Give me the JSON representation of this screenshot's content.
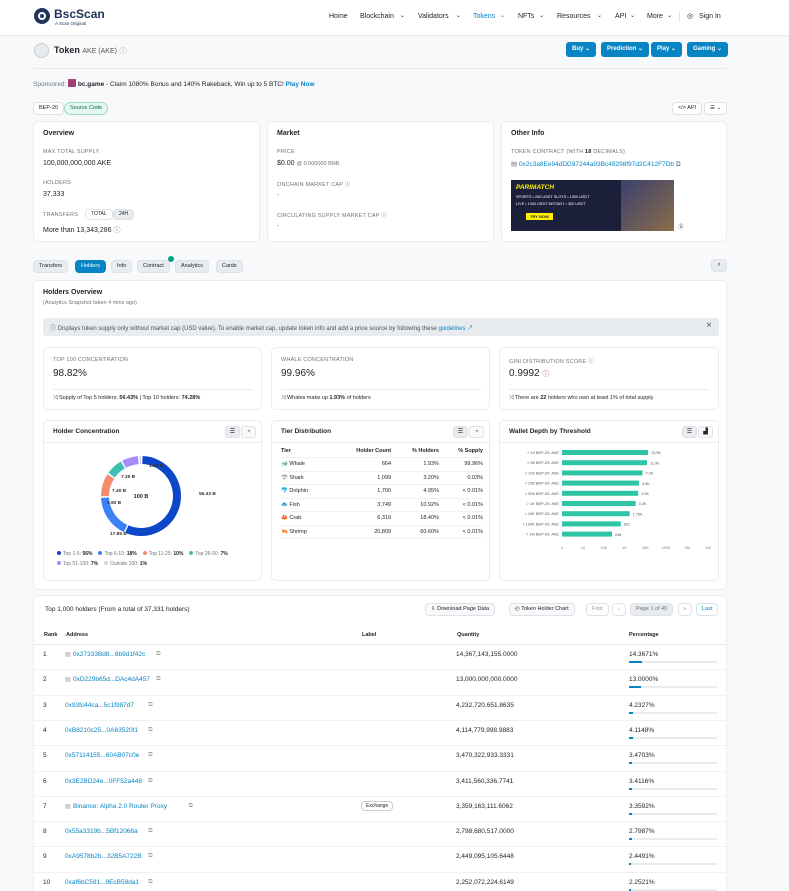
{
  "brand": {
    "name": "BscScan",
    "tagline": "A Scan Original"
  },
  "nav": [
    {
      "label": "Home"
    },
    {
      "label": "Blockchain"
    },
    {
      "label": "Validators"
    },
    {
      "label": "Tokens"
    },
    {
      "label": "NFTs"
    },
    {
      "label": "Resources"
    },
    {
      "label": "API"
    },
    {
      "label": "More"
    },
    {
      "label": "Sign In"
    }
  ],
  "token": {
    "prefix": "Token",
    "name": "AKE (AKE)"
  },
  "actions": {
    "buy": "Buy",
    "prediction": "Prediction",
    "play": "Play",
    "gaming": "Gaming"
  },
  "sponsored": {
    "label": "Sponsored:",
    "name": "bc.game",
    "text": " - Claim 1080% Bonus and 140% Rakeback, Win up to 5 BTC!",
    "link": "Play Now"
  },
  "badges": {
    "bep20": "BEP-20",
    "source": "Source Code",
    "api": "API"
  },
  "overview": {
    "title": "Overview",
    "max_supply_label": "MAX TOTAL SUPPLY",
    "max_supply": "100,000,000,000 AKE",
    "holders_label": "HOLDERS",
    "holders": "37,333",
    "transfers_label": "TRANSFERS",
    "total_tab": "TOTAL",
    "h24_tab": "24H",
    "transfers": "More than 13,343,286"
  },
  "market": {
    "title": "Market",
    "price_label": "PRICE",
    "price": "$0.00",
    "price_bnb": "@ 0.000000 BNB",
    "onchain_label": "ONCHAIN MARKET CAP",
    "onchain": "-",
    "circ_label": "CIRCULATING SUPPLY MARKET CAP",
    "circ": "-"
  },
  "other": {
    "title": "Other Info",
    "contract_label_a": "TOKEN CONTRACT (WITH ",
    "contract_decimals": "18",
    "contract_label_b": " DECIMALS)",
    "contract": "0x2c3a8Ee94dDD97244a93Bc48298f97d2C412F7Db"
  },
  "ad": {
    "brand": "PARIMATCH",
    "line1": "SPORTS • 200 USDT  SLOTS • 1300 USDT",
    "line2": "LIVE • 1000 USDT  INSTANT • 300 USDT",
    "cta": "TRY NOW"
  },
  "tabs": [
    {
      "label": "Transfers"
    },
    {
      "label": "Holders"
    },
    {
      "label": "Info"
    },
    {
      "label": "Contract"
    },
    {
      "label": "Analytics"
    },
    {
      "label": "Cards"
    }
  ],
  "holders_overview": {
    "title": "Holders Overview",
    "subtitle": "(Analytics Snapshot taken 4 mins ago)",
    "notice": "Displays token supply only without market cap (USD value). To enable market cap, update token info and add a price source by following these ",
    "notice_link": "guidelines"
  },
  "stats": [
    {
      "label": "TOP 100 CONCENTRATION",
      "value": "98.82%",
      "foot_a": "Supply of Top 5 holders: ",
      "foot_b": "56.43%",
      "foot_c": " | Top 10 holders: ",
      "foot_d": "74.28%"
    },
    {
      "label": "WHALE CONCENTRATION",
      "value": "99.96%",
      "foot_a": "Whales make up ",
      "foot_b": "1.93%",
      "foot_c": " of holders",
      "foot_d": ""
    },
    {
      "label": "GINI DISTRIBUTION SCORE",
      "value": "0.9992",
      "foot_a": "There are ",
      "foot_b": "22",
      "foot_c": " holders who own at least 1% of total supply",
      "foot_d": ""
    }
  ],
  "concentration": {
    "title": "Holder Concentration",
    "center": "100 B",
    "slices": [
      {
        "label": "56.43 B",
        "value": 56.43,
        "color": "#0d47c9"
      },
      {
        "label": "17.85 B",
        "value": 17.85,
        "color": "#3b82f6"
      },
      {
        "label": "9.90 B",
        "value": 9.9,
        "color": "#f28c6a"
      },
      {
        "label": "7.40 B",
        "value": 7.4,
        "color": "#3ec1b4"
      },
      {
        "label": "7.25 B",
        "value": 7.25,
        "color": "#a78bfa"
      },
      {
        "label": "1.18 B",
        "value": 1.18,
        "color": "#cbd5e1"
      }
    ],
    "legend": [
      {
        "name": "Top 1-5:",
        "pct": "56%",
        "color": "#0d47c9"
      },
      {
        "name": "Top 6-10:",
        "pct": "18%",
        "color": "#3b82f6"
      },
      {
        "name": "Top 11-25:",
        "pct": "10%",
        "color": "#f28c6a"
      },
      {
        "name": "Top 26-50:",
        "pct": "7%",
        "color": "#3ec1b4"
      },
      {
        "name": "Top 51-100:",
        "pct": "7%",
        "color": "#a78bfa"
      },
      {
        "name": "Outside 100:",
        "pct": "1%",
        "color": "#cbd5e1"
      }
    ]
  },
  "tiers": {
    "title": "Tier Distribution",
    "headers": [
      "Tier",
      "Holder Count",
      "% Holders",
      "% Supply"
    ],
    "rows": [
      {
        "icon": "🐋",
        "tier": "Whale",
        "count": "664",
        "holders": "1.93%",
        "supply": "99.96%"
      },
      {
        "icon": "🦈",
        "tier": "Shark",
        "count": "1,099",
        "holders": "3.20%",
        "supply": "0.03%"
      },
      {
        "icon": "🐬",
        "tier": "Dolphin",
        "count": "1,700",
        "holders": "4.95%",
        "supply": "< 0.01%"
      },
      {
        "icon": "🐟",
        "tier": "Fish",
        "count": "3,749",
        "holders": "10.92%",
        "supply": "< 0.01%"
      },
      {
        "icon": "🦀",
        "tier": "Crab",
        "count": "6,319",
        "holders": "18.40%",
        "supply": "< 0.01%"
      },
      {
        "icon": "🦐",
        "tier": "Shrimp",
        "count": "20,809",
        "holders": "60.60%",
        "supply": "< 0.01%"
      }
    ]
  },
  "wallet_depth": {
    "title": "Wallet Depth by Threshold"
  },
  "chart_data": {
    "type": "bar",
    "orientation": "horizontal",
    "title": "Wallet Depth by Threshold",
    "categories": [
      "> 10 BEP-20: AKE",
      "> 50 BEP-20: AKE",
      "> 100 BEP-20: AKE",
      "> 250 BEP-20: AKE",
      "> 500 BEP-20: AKE",
      "> 1K BEP-20: AKE",
      "> 10K BEP-20: AKE",
      "> 100K BEP-20: AKE",
      "> 1M BEP-20: AKE"
    ],
    "values": [
      13500,
      11900,
      7200,
      4900,
      4500,
      3400,
      1760,
      661,
      248
    ],
    "data_labels": [
      "13.5K",
      "11.9K",
      "7.2K",
      "4.9K",
      "4.5K",
      "3.4K",
      "1.76K",
      "661",
      "248"
    ],
    "x_ticks": [
      "1",
      "10",
      "100",
      "1K",
      "10K",
      "100K",
      "1M",
      "1M"
    ],
    "xscale": "log",
    "color": "#2ec4a6"
  },
  "holders_table": {
    "title": "Top 1,000 holders (From a total of 37,331 holders)",
    "download": "Download Page Data",
    "chart_btn": "Token Holder Chart",
    "first": "First",
    "page": "Page 1 of 40",
    "last": "Last",
    "headers": [
      "Rank",
      "Address",
      "Label",
      "Quantity",
      "Percentage"
    ],
    "rows": [
      {
        "rank": "1",
        "address": "0x27333Bd8...6b9d1f42c",
        "label": "",
        "qty": "14,367,143,155.0000",
        "pct": "14.3671%",
        "frac": 0.143671,
        "contract": true
      },
      {
        "rank": "2",
        "address": "0xD229b65d...DAc4dA457",
        "label": "",
        "qty": "13,000,000,000.0000",
        "pct": "13.0000%",
        "frac": 0.13,
        "contract": true
      },
      {
        "rank": "3",
        "address": "0x93fc44ca...5c1f987d7",
        "label": "",
        "qty": "4,232,720,651.8635",
        "pct": "4.2327%",
        "frac": 0.042327,
        "contract": false
      },
      {
        "rank": "4",
        "address": "0xB8210c25...0A63520f1",
        "label": "",
        "qty": "4,114,779,998.9883",
        "pct": "4.1148%",
        "frac": 0.041148,
        "contract": false
      },
      {
        "rank": "5",
        "address": "0x57114155...60AB07c0e",
        "label": "",
        "qty": "3,470,322,933.3331",
        "pct": "3.4703%",
        "frac": 0.034703,
        "contract": false
      },
      {
        "rank": "6",
        "address": "0x3E2BD24e...0FF52a448",
        "label": "",
        "qty": "3,411,560,336.7741",
        "pct": "3.4116%",
        "frac": 0.034116,
        "contract": false
      },
      {
        "rank": "7",
        "address": "Binance: Alpha 2.0 Router Proxy",
        "label": "Exchange",
        "qty": "3,359,163,111.6062",
        "pct": "3.3592%",
        "frac": 0.033592,
        "contract": true
      },
      {
        "rank": "8",
        "address": "0x55a3319b...5Bf12066a",
        "label": "",
        "qty": "2,798,680,517.0000",
        "pct": "2.7987%",
        "frac": 0.027987,
        "contract": false
      },
      {
        "rank": "9",
        "address": "0xA9578b2b...32B5A722B",
        "label": "",
        "qty": "2,449,095,105.6448",
        "pct": "2.4491%",
        "frac": 0.024491,
        "contract": false
      },
      {
        "rank": "10",
        "address": "0xaf6bC591...9EcB59da1",
        "label": "",
        "qty": "2,252,072,224.6149",
        "pct": "2.2521%",
        "frac": 0.022521,
        "contract": false
      }
    ]
  }
}
